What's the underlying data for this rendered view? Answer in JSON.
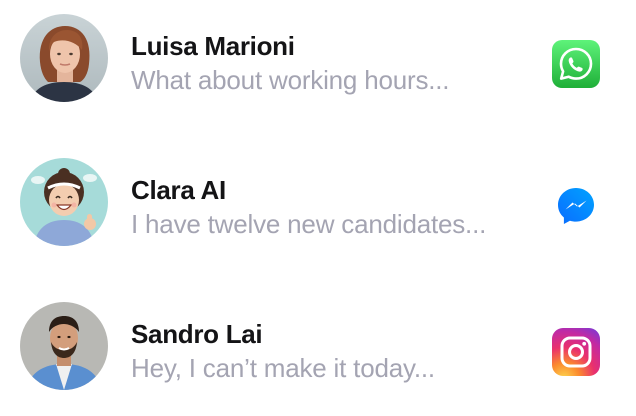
{
  "conversations": [
    {
      "name": "Luisa Marioni",
      "preview": "What about working hours...",
      "avatar": "woman-portrait-avatar",
      "app": "whatsapp-icon",
      "app_color": "#25d366"
    },
    {
      "name": "Clara AI",
      "preview": "I have twelve new candidates...",
      "avatar": "ai-cartoon-avatar",
      "app": "messenger-icon",
      "app_color": "#0a7cff"
    },
    {
      "name": "Sandro Lai",
      "preview": "Hey, I can’t make it today...",
      "avatar": "man-portrait-avatar",
      "app": "instagram-icon",
      "app_color": "#e1306c"
    }
  ]
}
